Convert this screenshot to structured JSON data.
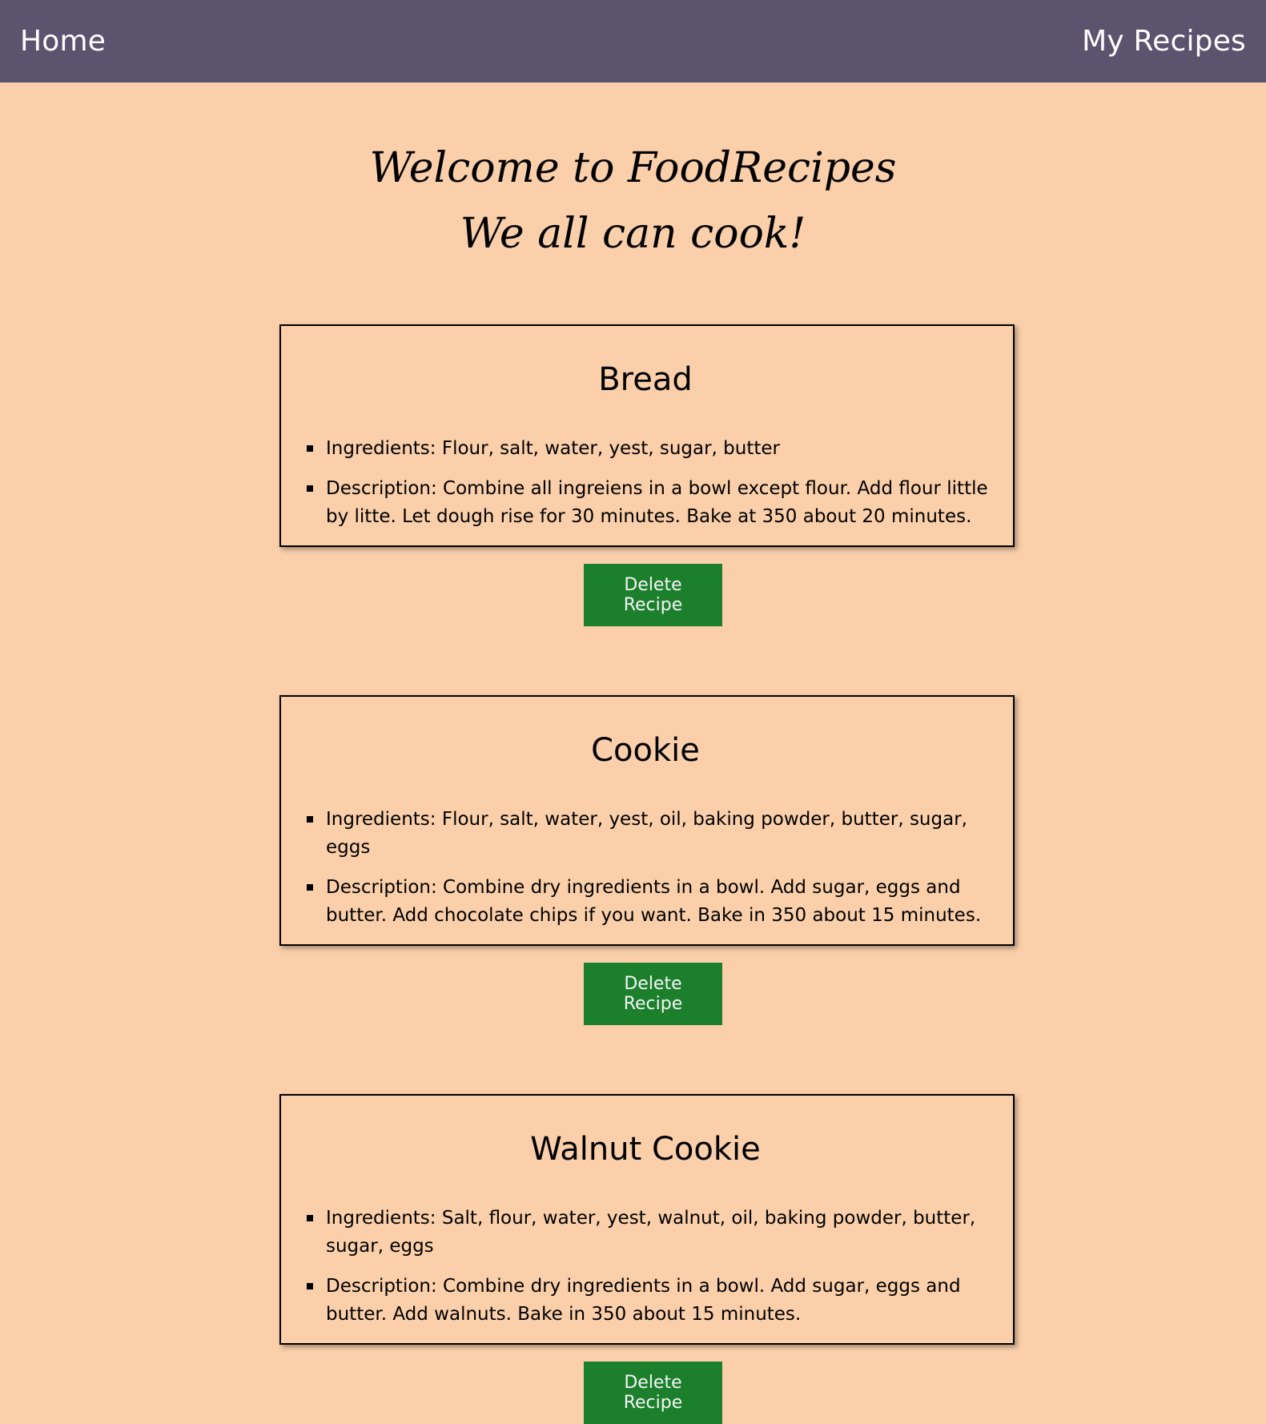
{
  "nav": {
    "home_label": "Home",
    "my_recipes_label": "My Recipes"
  },
  "hero": {
    "line1": "Welcome to FoodRecipes",
    "line2": "We all can cook!"
  },
  "colors": {
    "navbar_bg": "#5c536e",
    "page_bg": "#facfaa",
    "button_bg": "#1b7f2c"
  },
  "recipes": [
    {
      "title": "Bread",
      "ingredients": "Ingredients: Flour, salt, water, yest, sugar, butter",
      "description": "Description: Combine all ingreiens in a bowl except flour. Add flour little by litte. Let dough rise for 30 minutes. Bake at 350 about 20 minutes.",
      "delete_label": "Delete Recipe"
    },
    {
      "title": "Cookie",
      "ingredients": "Ingredients: Flour, salt, water, yest, oil, baking powder, butter, sugar, eggs",
      "description": "Description: Combine dry ingredients in a bowl. Add sugar, eggs and butter. Add chocolate chips if you want. Bake in 350 about 15 minutes.",
      "delete_label": "Delete Recipe"
    },
    {
      "title": "Walnut Cookie",
      "ingredients": "Ingredients: Salt, flour, water, yest, walnut, oil, baking powder, butter, sugar, eggs",
      "description": "Description: Combine dry ingredients in a bowl. Add sugar, eggs and butter. Add walnuts. Bake in 350 about 15 minutes.",
      "delete_label": "Delete Recipe"
    }
  ]
}
